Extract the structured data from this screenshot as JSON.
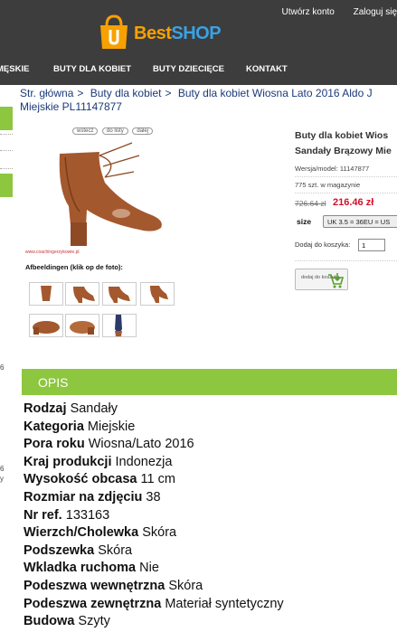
{
  "header": {
    "top_links": [
      "Utwórz konto",
      "Zaloguj się"
    ],
    "logo": {
      "letter": "U",
      "best": "Best",
      "shop": "SHOP"
    },
    "nav": [
      "MĘSKIE",
      "BUTY DLA KOBIET",
      "BUTY DZIECIĘCE",
      "KONTAKT"
    ]
  },
  "breadcrumb": {
    "items": [
      "Str. główna",
      "Buty dla kobiet",
      "Buty dla kobiet Wiosna Lato 2016 Aldo J"
    ],
    "separator": ">",
    "line2": "Miejskie PL11147877"
  },
  "sidebar_edge": {
    "numbers": [
      "6",
      "6",
      "y"
    ]
  },
  "gallery": {
    "controls": [
      "wstecz",
      "do listy",
      "dalej"
    ],
    "watermark": "www.coachingerzykowie.pl",
    "thumbs_label": "Afbeeldingen (klik op de foto):"
  },
  "product": {
    "name_line1": "Buty dla kobiet Wios",
    "name_line2": "Sandały Brązowy Mie",
    "model": "Wersja/model: 11147877",
    "stock": "775 szt. w magazynie",
    "old_price": "726.64 zł",
    "new_price": "216.46 zł",
    "size_label": "size",
    "size_value": "UK 3.5 = 36EU = US",
    "qty_label": "Dodaj do koszyka:",
    "qty_value": "1",
    "add_button": "dodaj do koszyka"
  },
  "description": {
    "title": "OPIS",
    "attributes": [
      {
        "key": "Rodzaj",
        "value": "Sandały"
      },
      {
        "key": "Kategoria",
        "value": "Miejskie"
      },
      {
        "key": "Pora roku",
        "value": "Wiosna/Lato 2016"
      },
      {
        "key": "Kraj produkcji",
        "value": "Indonezja"
      },
      {
        "key": "Wysokość obcasa",
        "value": "11 cm"
      },
      {
        "key": "Rozmiar na zdjęciu",
        "value": "38"
      },
      {
        "key": "Nr ref.",
        "value": "133163"
      },
      {
        "key": "Wierzch/Cholewka",
        "value": "Skóra"
      },
      {
        "key": "Podszewka",
        "value": "Skóra"
      },
      {
        "key": "Wkladka ruchoma",
        "value": "Nie"
      },
      {
        "key": "Podeszwa wewnętrzna",
        "value": "Skóra"
      },
      {
        "key": "Podeszwa zewnętrzna",
        "value": "Materiał syntetyczny"
      },
      {
        "key": "Budowa",
        "value": "Szyty"
      }
    ]
  },
  "colors": {
    "header_bg": "#3d3d3d",
    "accent_green": "#8dc63f",
    "price_red": "#d0102a",
    "link_blue": "#1a3a7a",
    "logo_orange": "#f7a100",
    "logo_blue": "#3aa2e3"
  }
}
